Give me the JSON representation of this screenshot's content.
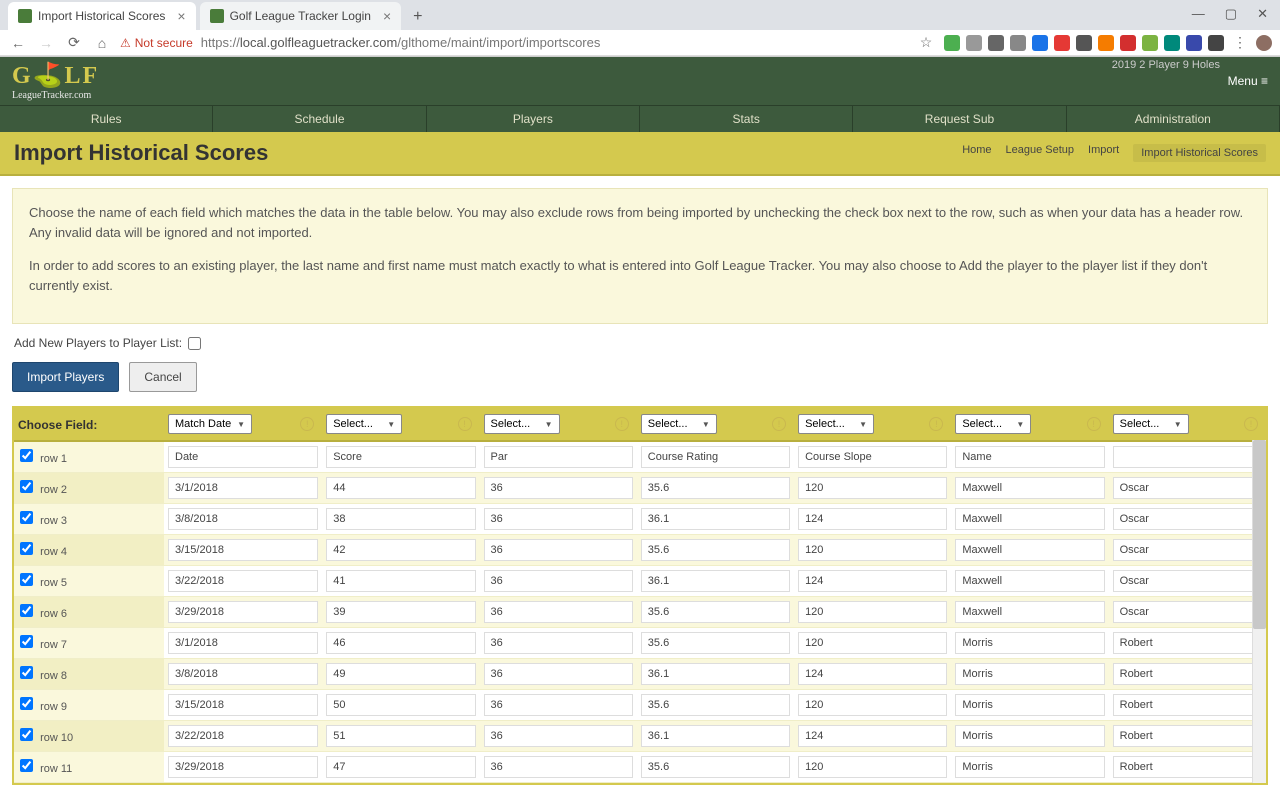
{
  "browser": {
    "tabs": [
      {
        "title": "Import Historical Scores",
        "active": true
      },
      {
        "title": "Golf League Tracker Login",
        "active": false
      }
    ],
    "security_label": "Not secure",
    "url_proto": "https://",
    "url_host": "local.golfleaguetracker.com",
    "url_path": "/glthome/maint/import/importscores"
  },
  "app": {
    "logo_main": "G⛳LF",
    "logo_sub": "LeagueTracker.com",
    "season": "2019 2 Player 9 Holes",
    "menu_label": "Menu ≡",
    "nav": [
      "Rules",
      "Schedule",
      "Players",
      "Stats",
      "Request Sub",
      "Administration"
    ]
  },
  "page": {
    "title": "Import Historical Scores",
    "breadcrumb": [
      "Home",
      "League Setup",
      "Import",
      "Import Historical Scores"
    ]
  },
  "info": {
    "p1": "Choose the name of each field which matches the data in the table below. You may also exclude rows from being imported by unchecking the check box next to the row, such as when your data has a header row. Any invalid data will be ignored and not imported.",
    "p2": "In order to add scores to an existing player, the last name and first name must match exactly to what is entered into Golf League Tracker. You may also choose to Add the player to the player list if they don't currently exist."
  },
  "controls": {
    "checkbox_label": "Add New Players to Player List:",
    "import_btn": "Import Players",
    "cancel_btn": "Cancel"
  },
  "table": {
    "choose_label": "Choose Field:",
    "col_selects": [
      "Match Date",
      "Select...",
      "Select...",
      "Select...",
      "Select...",
      "Select...",
      "Select..."
    ],
    "rows": [
      {
        "label": "row 1",
        "cells": [
          "Date",
          "Score",
          "Par",
          "Course Rating",
          "Course Slope",
          "Name",
          ""
        ]
      },
      {
        "label": "row 2",
        "cells": [
          "3/1/2018",
          "44",
          "36",
          "35.6",
          "120",
          "Maxwell",
          "Oscar"
        ]
      },
      {
        "label": "row 3",
        "cells": [
          "3/8/2018",
          "38",
          "36",
          "36.1",
          "124",
          "Maxwell",
          "Oscar"
        ]
      },
      {
        "label": "row 4",
        "cells": [
          "3/15/2018",
          "42",
          "36",
          "35.6",
          "120",
          "Maxwell",
          "Oscar"
        ]
      },
      {
        "label": "row 5",
        "cells": [
          "3/22/2018",
          "41",
          "36",
          "36.1",
          "124",
          "Maxwell",
          "Oscar"
        ]
      },
      {
        "label": "row 6",
        "cells": [
          "3/29/2018",
          "39",
          "36",
          "35.6",
          "120",
          "Maxwell",
          "Oscar"
        ]
      },
      {
        "label": "row 7",
        "cells": [
          "3/1/2018",
          "46",
          "36",
          "35.6",
          "120",
          "Morris",
          "Robert"
        ]
      },
      {
        "label": "row 8",
        "cells": [
          "3/8/2018",
          "49",
          "36",
          "36.1",
          "124",
          "Morris",
          "Robert"
        ]
      },
      {
        "label": "row 9",
        "cells": [
          "3/15/2018",
          "50",
          "36",
          "35.6",
          "120",
          "Morris",
          "Robert"
        ]
      },
      {
        "label": "row 10",
        "cells": [
          "3/22/2018",
          "51",
          "36",
          "36.1",
          "124",
          "Morris",
          "Robert"
        ]
      },
      {
        "label": "row 11",
        "cells": [
          "3/29/2018",
          "47",
          "36",
          "35.6",
          "120",
          "Morris",
          "Robert"
        ]
      }
    ]
  }
}
